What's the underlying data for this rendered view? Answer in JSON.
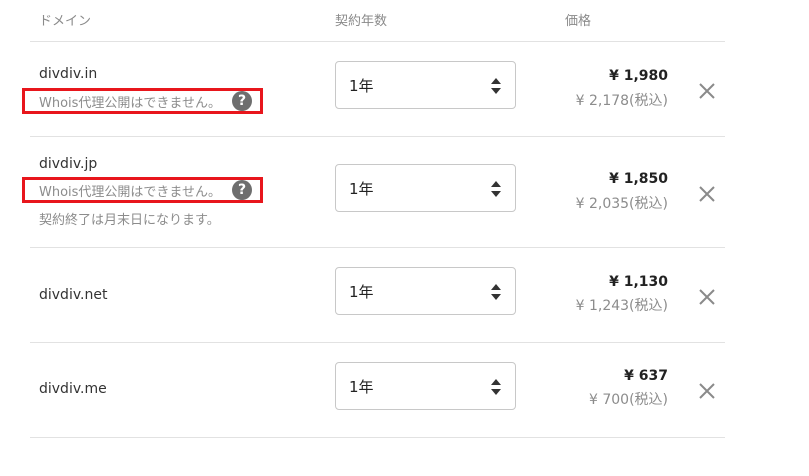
{
  "header": {
    "domain": "ドメイン",
    "term": "契約年数",
    "price": "価格"
  },
  "rows": [
    {
      "domain": "divdiv.in",
      "whois": "Whois代理公開はできません。",
      "term": "1年",
      "price": "¥ 1,980",
      "price_tax": "¥ 2,178(税込)"
    },
    {
      "domain": "divdiv.jp",
      "whois": "Whois代理公開はできません。",
      "note": "契約終了は月末日になります。",
      "term": "1年",
      "price": "¥ 1,850",
      "price_tax": "¥ 2,035(税込)"
    },
    {
      "domain": "divdiv.net",
      "term": "1年",
      "price": "¥ 1,130",
      "price_tax": "¥ 1,243(税込)"
    },
    {
      "domain": "divdiv.me",
      "term": "1年",
      "price": "¥ 637",
      "price_tax": "¥ 700(税込)"
    }
  ],
  "help_icon_glyph": "?",
  "colors": {
    "highlight": "#e8161c",
    "help_icon": "#6e6e6e"
  }
}
